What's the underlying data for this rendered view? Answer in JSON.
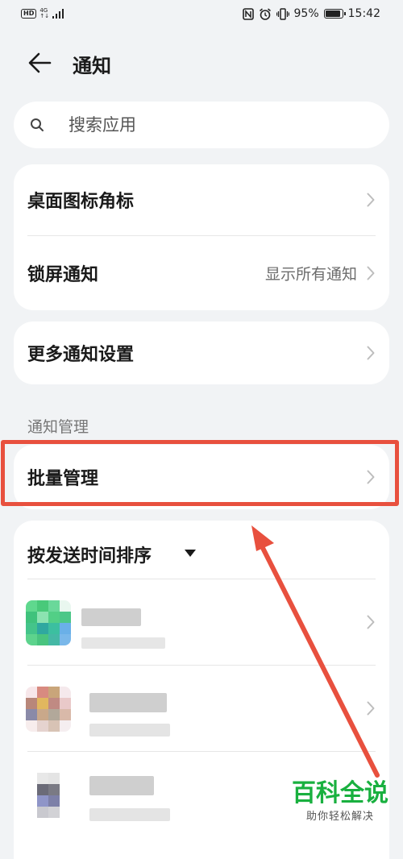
{
  "status_bar": {
    "left_badge": "HD",
    "network_gen": "4G",
    "battery": "95%",
    "battery_level": 0.95,
    "time": "15:42"
  },
  "header": {
    "title": "通知"
  },
  "search": {
    "placeholder": "搜索应用"
  },
  "card1": {
    "items": [
      {
        "label": "桌面图标角标",
        "value": ""
      },
      {
        "label": "锁屏通知",
        "value": "显示所有通知"
      }
    ]
  },
  "card2": {
    "items": [
      {
        "label": "更多通知设置"
      }
    ]
  },
  "section": {
    "title": "通知管理"
  },
  "batch": {
    "label": "批量管理"
  },
  "apps_card": {
    "sort_label": "按发送时间排序"
  },
  "watermark": {
    "title": "百科全说",
    "subtitle": "助你轻松解决"
  },
  "colors": {
    "highlight": "#e8503e",
    "watermark": "#19b03f"
  }
}
